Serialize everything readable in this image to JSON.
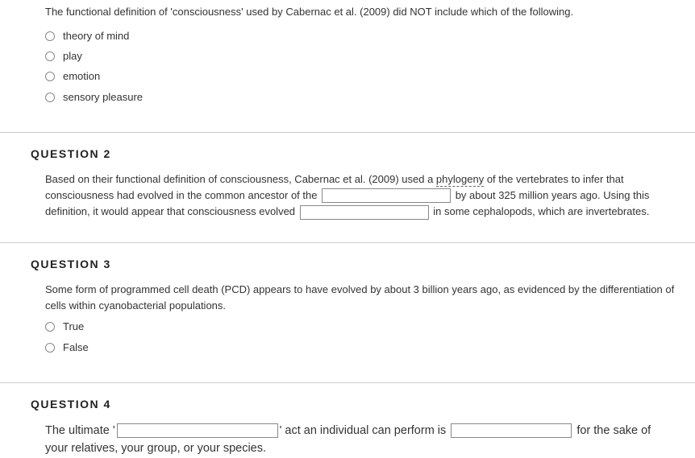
{
  "q1": {
    "prompt": "The functional definition of 'consciousness' used by Cabernac et al. (2009) did NOT include which of the following.",
    "options": [
      "theory of mind",
      "play",
      "emotion",
      "sensory pleasure"
    ]
  },
  "q2": {
    "heading": "QUESTION 2",
    "text_part1": "Based on their functional definition of consciousness, Cabernac et al. (2009) used a ",
    "text_underlined": "phylogeny",
    "text_part2": " of the vertebrates to infer that consciousness had evolved in the common ancestor of the ",
    "text_part3": " by about 325 million years ago.  Using this definition, it would appear that consciousness evolved ",
    "text_part4": " in some cephalopods, which are invertebrates."
  },
  "q3": {
    "heading": "QUESTION 3",
    "prompt": "Some form of programmed cell death (PCD) appears to have evolved by about 3 billion years ago, as evidenced by the differentiation of cells within cyanobacterial populations.",
    "options": [
      "True",
      "False"
    ]
  },
  "q4": {
    "heading": "QUESTION 4",
    "text_part1": "The ultimate '",
    "text_part2": "' act an individual can perform is ",
    "text_part3": " for the sake of your relatives, your group, or your species."
  }
}
